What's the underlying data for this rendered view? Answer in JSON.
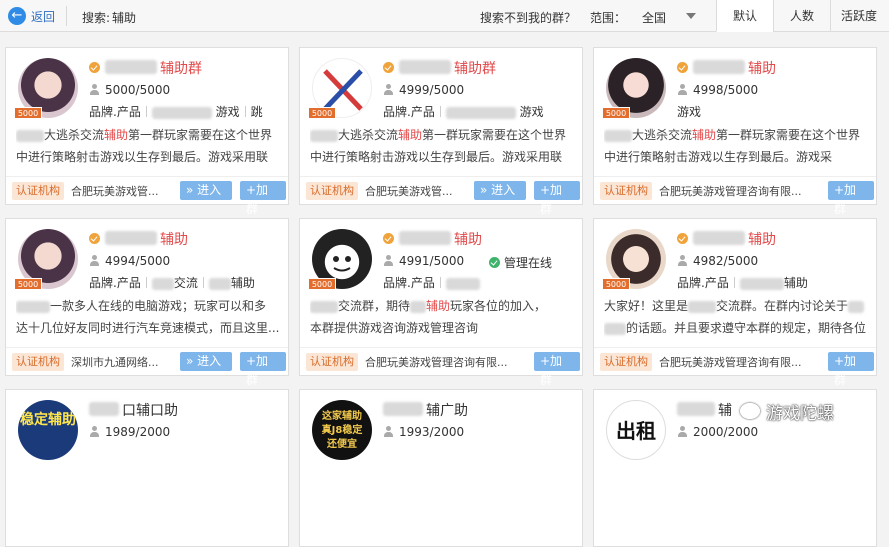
{
  "topbar": {
    "back_label": "返回",
    "search_label": "搜索:",
    "search_value": "辅助",
    "not_found": "搜索不到我的群？",
    "range_label": "范围：",
    "range_value": "全国",
    "tabs": [
      "默认",
      "人数",
      "活跃度"
    ]
  },
  "cards": [
    {
      "name": "辅助群",
      "members": "5000/5000",
      "badge": "5000",
      "tags": [
        "品牌.产品",
        "游戏",
        "跳"
      ],
      "desc1_pre": "大逃杀交流",
      "desc1_hl": "辅助",
      "desc1_post": "第一群玩家需要在这个世界",
      "desc2": "中进行策略射击游戏以生存到最后。游戏采用联",
      "cert": "认证机构",
      "org": "合肥玩美游戏管...",
      "enter": "» 进入",
      "join": "+加群"
    },
    {
      "name": "辅助群",
      "members": "4999/5000",
      "badge": "5000",
      "tags": [
        "品牌.产品",
        "游戏"
      ],
      "desc1_pre": "大逃杀交流",
      "desc1_hl": "辅助",
      "desc1_post": "第一群玩家需要在这个世界",
      "desc2": "中进行策略射击游戏以生存到最后。游戏采用联",
      "cert": "认证机构",
      "org": "合肥玩美游戏管...",
      "enter": "» 进入",
      "join": "+加群"
    },
    {
      "name": "辅助",
      "members": "4998/5000",
      "badge": "5000",
      "tags": [
        "游戏"
      ],
      "desc1_pre": "大逃杀交流",
      "desc1_hl": "辅助",
      "desc1_post": "第一群玩家需要在这个世界",
      "desc2": "中进行策略射击游戏以生存到最后。游戏采",
      "cert": "认证机构",
      "org": "合肥玩美游戏管理咨询有限...",
      "enter": "",
      "join": "+加群"
    },
    {
      "name": "辅助",
      "members": "4994/5000",
      "badge": "5000",
      "tags": [
        "品牌.产品",
        "交流",
        "辅助"
      ],
      "desc1_pre": "",
      "desc1_hl": "",
      "desc1_post": "一款多人在线的电脑游戏；玩家可以和多",
      "desc2": "达十几位好友同时进行汽车竞速模式，而且这里...",
      "cert": "认证机构",
      "org": "深圳市九通网络...",
      "enter": "» 进入",
      "join": "+加群"
    },
    {
      "name": "辅助",
      "members": "4991/5000",
      "badge": "5000",
      "online": "管理在线",
      "tags": [
        "品牌.产品"
      ],
      "desc1_pre": "交流群，期待",
      "desc1_hl": "辅助",
      "desc1_post": "玩家各位的加入，",
      "desc2": "本群提供游戏咨询游戏管理咨询",
      "cert": "认证机构",
      "org": "合肥玩美游戏管理咨询有限...",
      "enter": "",
      "join": "+加群"
    },
    {
      "name": "辅助",
      "members": "4982/5000",
      "badge": "5000",
      "tags": [
        "品牌.产品",
        "辅助"
      ],
      "desc1_pre": "大家好！这里是",
      "desc1_hl": "",
      "desc1_post": "交流群。在群内讨论关于",
      "desc2": "的话题。并且要求遵守本群的规定，期待各位的...",
      "cert": "认证机构",
      "org": "合肥玩美游戏管理咨询有限...",
      "enter": "",
      "join": "+加群"
    },
    {
      "name": "口辅口助",
      "members": "1989/2000",
      "avatar_text": "稳定辅助"
    },
    {
      "name": "辅广助",
      "members": "1993/2000",
      "avatar_text": "这家辅助 真J8稳定 还便宜"
    },
    {
      "name": "辅",
      "members": "2000/2000",
      "avatar_text": "出租"
    }
  ],
  "watermark": "游戏陀螺"
}
